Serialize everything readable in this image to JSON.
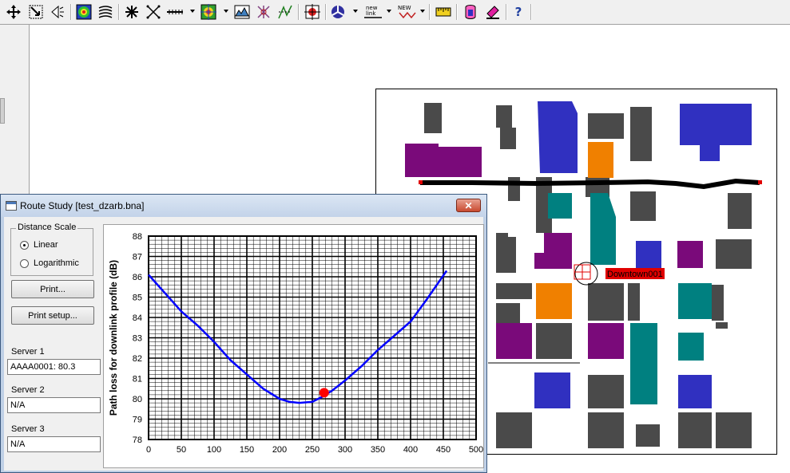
{
  "toolbar": {
    "icons": [
      "move-icon",
      "zoom-window-icon",
      "zoom-out-icon",
      "coverage-map-icon",
      "contour-icon",
      "sites-icon",
      "links-icon",
      "path-icon",
      "signal-icon",
      "terrain-icon",
      "interference-icon",
      "route-icon",
      "target-icon",
      "network-icon",
      "new-link-icon",
      "new-site-icon",
      "ruler-icon",
      "database-icon",
      "paint-icon",
      "help-icon"
    ],
    "new_link_label": "new link",
    "new_site_label": "NEW",
    "help_label": "?"
  },
  "map": {
    "site_label": "Downtown001",
    "colors": {
      "building": "#4a4a4a",
      "purple": "#7a0a7a",
      "blue": "#3030c0",
      "orange": "#f08000",
      "teal": "#008080",
      "route": "#000000",
      "label_bg": "#e00000"
    }
  },
  "dialog": {
    "title": "Route Study [test_dzarb.bna]",
    "close_label": "✕",
    "distance_scale": {
      "label": "Distance Scale",
      "options": [
        {
          "label": "Linear",
          "selected": true
        },
        {
          "label": "Logarithmic",
          "selected": false
        }
      ]
    },
    "print_label": "Print...",
    "print_setup_label": "Print setup...",
    "servers": [
      {
        "label": "Server 1",
        "value": "AAAA0001: 80.3"
      },
      {
        "label": "Server 2",
        "value": "N/A"
      },
      {
        "label": "Server 3",
        "value": "N/A"
      }
    ]
  },
  "chart_data": {
    "type": "line",
    "title": "",
    "xlabel": "",
    "ylabel": "Path loss for downlink profile (dB)",
    "xlim": [
      0,
      500
    ],
    "ylim": [
      78,
      88
    ],
    "x_ticks": [
      "0",
      "50",
      "100",
      "150",
      "200",
      "250",
      "300",
      "350",
      "400",
      "450",
      "500"
    ],
    "y_ticks": [
      "78",
      "79",
      "80",
      "81",
      "82",
      "83",
      "84",
      "85",
      "86",
      "87",
      "88"
    ],
    "grid": true,
    "series": [
      {
        "color": "#0000ff",
        "x": [
          0,
          25,
          50,
          75,
          100,
          125,
          150,
          175,
          200,
          215,
          230,
          250,
          265,
          280,
          300,
          325,
          350,
          375,
          400,
          425,
          455
        ],
        "y": [
          86.1,
          85.2,
          84.3,
          83.6,
          82.8,
          81.9,
          81.2,
          80.5,
          80.0,
          79.85,
          79.8,
          79.85,
          80.1,
          80.4,
          80.9,
          81.6,
          82.4,
          83.1,
          83.8,
          84.9,
          86.3
        ]
      }
    ],
    "marker": {
      "x": 268,
      "y": 80.3,
      "color": "#ff0000"
    }
  }
}
